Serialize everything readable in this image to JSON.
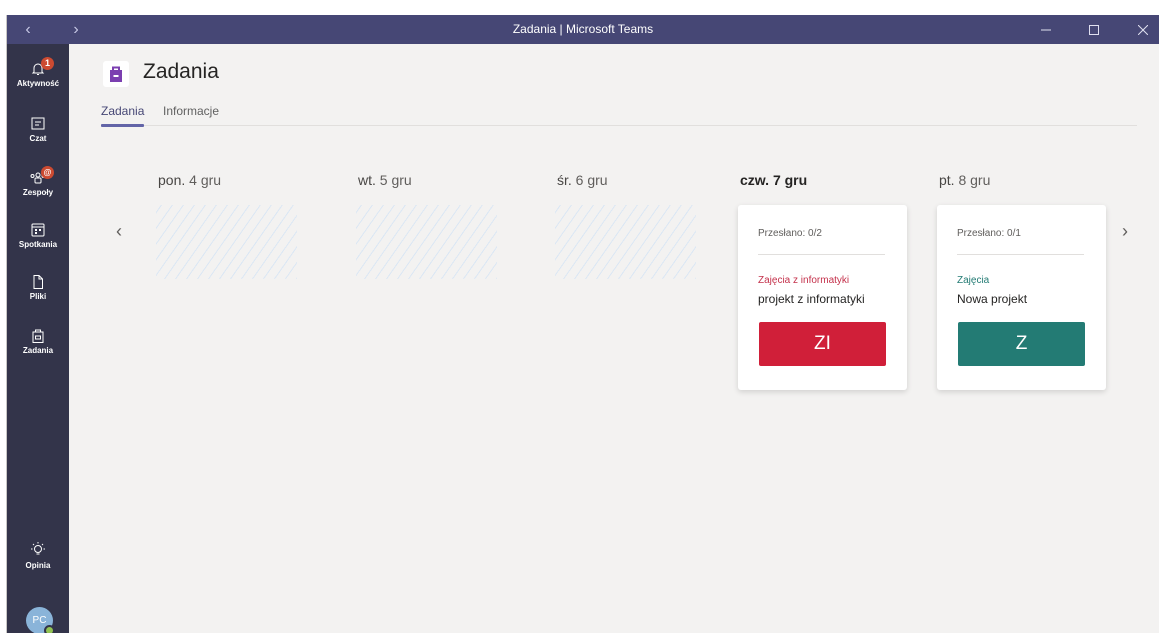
{
  "window": {
    "title": "Zadania | Microsoft Teams",
    "titlebar_color": "#464775"
  },
  "rail": {
    "items": [
      {
        "label": "Aktywność",
        "icon": "bell-icon",
        "badge": "1"
      },
      {
        "label": "Czat",
        "icon": "chat-icon"
      },
      {
        "label": "Zespoły",
        "icon": "teams-icon",
        "badge": "@"
      },
      {
        "label": "Spotkania",
        "icon": "calendar-icon"
      },
      {
        "label": "Pliki",
        "icon": "file-icon"
      },
      {
        "label": "Zadania",
        "icon": "assignments-icon"
      }
    ],
    "feedback": {
      "label": "Opinia",
      "icon": "lightbulb-icon"
    },
    "avatar": {
      "initials": "PC",
      "status_color": "#92c353"
    }
  },
  "header": {
    "title": "Zadania",
    "tabs": [
      {
        "label": "Zadania",
        "active": true
      },
      {
        "label": "Informacje",
        "active": false
      }
    ]
  },
  "days": [
    {
      "weekday": "pon.",
      "date": "4 gru",
      "today": false
    },
    {
      "weekday": "wt.",
      "date": "5 gru",
      "today": false
    },
    {
      "weekday": "śr.",
      "date": "6 gru",
      "today": false
    },
    {
      "weekday": "czw.",
      "date": "7 gru",
      "today": true
    },
    {
      "weekday": "pt.",
      "date": "8 gru",
      "today": false
    }
  ],
  "cards": [
    {
      "submitted": "Przesłano: 0/2",
      "class_name": "Zajęcia z informatyki",
      "assignment": "projekt z informatyki",
      "initials": "ZI",
      "color": "#c4314b",
      "class_color": "#c4314b"
    },
    {
      "submitted": "Przesłano: 0/1",
      "class_name": "Zajęcia",
      "assignment": "Nowa projekt",
      "initials": "Z",
      "color": "#237b74",
      "class_color": "#237b74"
    }
  ],
  "nav": {
    "prev": "‹",
    "next": "›"
  }
}
